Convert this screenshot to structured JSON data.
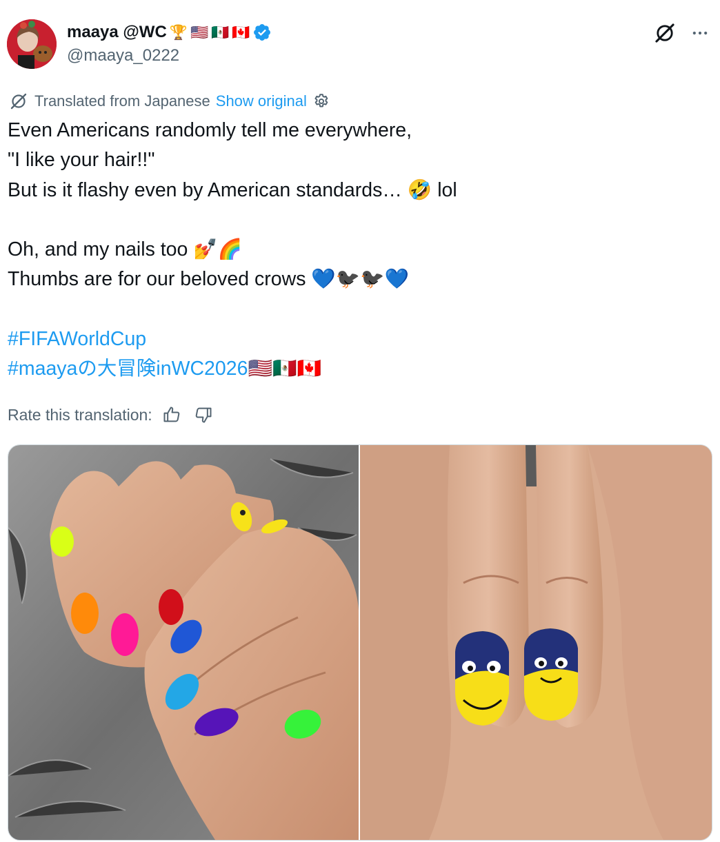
{
  "author": {
    "display_name": "maaya @WC",
    "name_emojis": [
      "🏆",
      "🇺🇸",
      "🇲🇽",
      "🇨🇦"
    ],
    "handle": "@maaya_0222",
    "verified": true,
    "verified_color": "#1d9bf0"
  },
  "icons": {
    "grok": "grok-icon",
    "more": "more-icon",
    "translate": "translate-icon",
    "settings": "gear-icon",
    "thumbs_up": "thumbs-up-icon",
    "thumbs_down": "thumbs-down-icon"
  },
  "translation": {
    "label": "Translated from Japanese",
    "show_original": "Show original"
  },
  "post": {
    "line1": "Even Americans randomly tell me everywhere,",
    "line2": "\"I like your hair!!\"",
    "line3_text": "But is it flashy even by American standards… ",
    "line3_emoji": "🤣",
    "line3_suffix": " lol",
    "line4_text": "Oh, and my nails too ",
    "line4_emoji": "💅🌈",
    "line5_text": "Thumbs are for our beloved crows ",
    "line5_emoji": "💙🐦‍⬛🐦‍⬛💙",
    "hashtag1": "#FIFAWorldCup",
    "hashtag2": "#maayaの大冒険inWC2026",
    "hashtag2_emoji": "🇺🇸🇲🇽🇨🇦"
  },
  "rate": {
    "label": "Rate this translation:"
  },
  "colors": {
    "text": "#0f1419",
    "secondary": "#536471",
    "link": "#1d9bf0"
  }
}
